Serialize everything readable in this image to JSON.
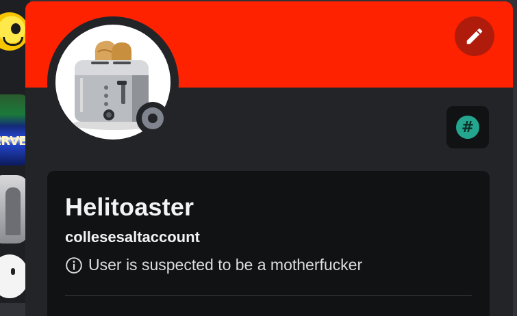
{
  "profile": {
    "display_name": "Helitoaster",
    "username": "collesesaltaccount",
    "custom_status": "User is suspected to be a motherfucker",
    "presence": "offline",
    "badge_symbol": "#",
    "avatar": "toaster-avatar"
  },
  "server_rail": {
    "partial_text": "ERVE"
  },
  "colors": {
    "banner": "#ff2200",
    "edit_button": "#b01c0c",
    "card_background": "#111214",
    "popout_background": "#232428",
    "badge": "#23a58e",
    "status_offline": "#80848e"
  },
  "icons": {
    "edit": "pencil-icon",
    "status_info": "info-circle-icon",
    "badge": "hashtag-badge-icon",
    "presence": "offline-status-icon"
  }
}
